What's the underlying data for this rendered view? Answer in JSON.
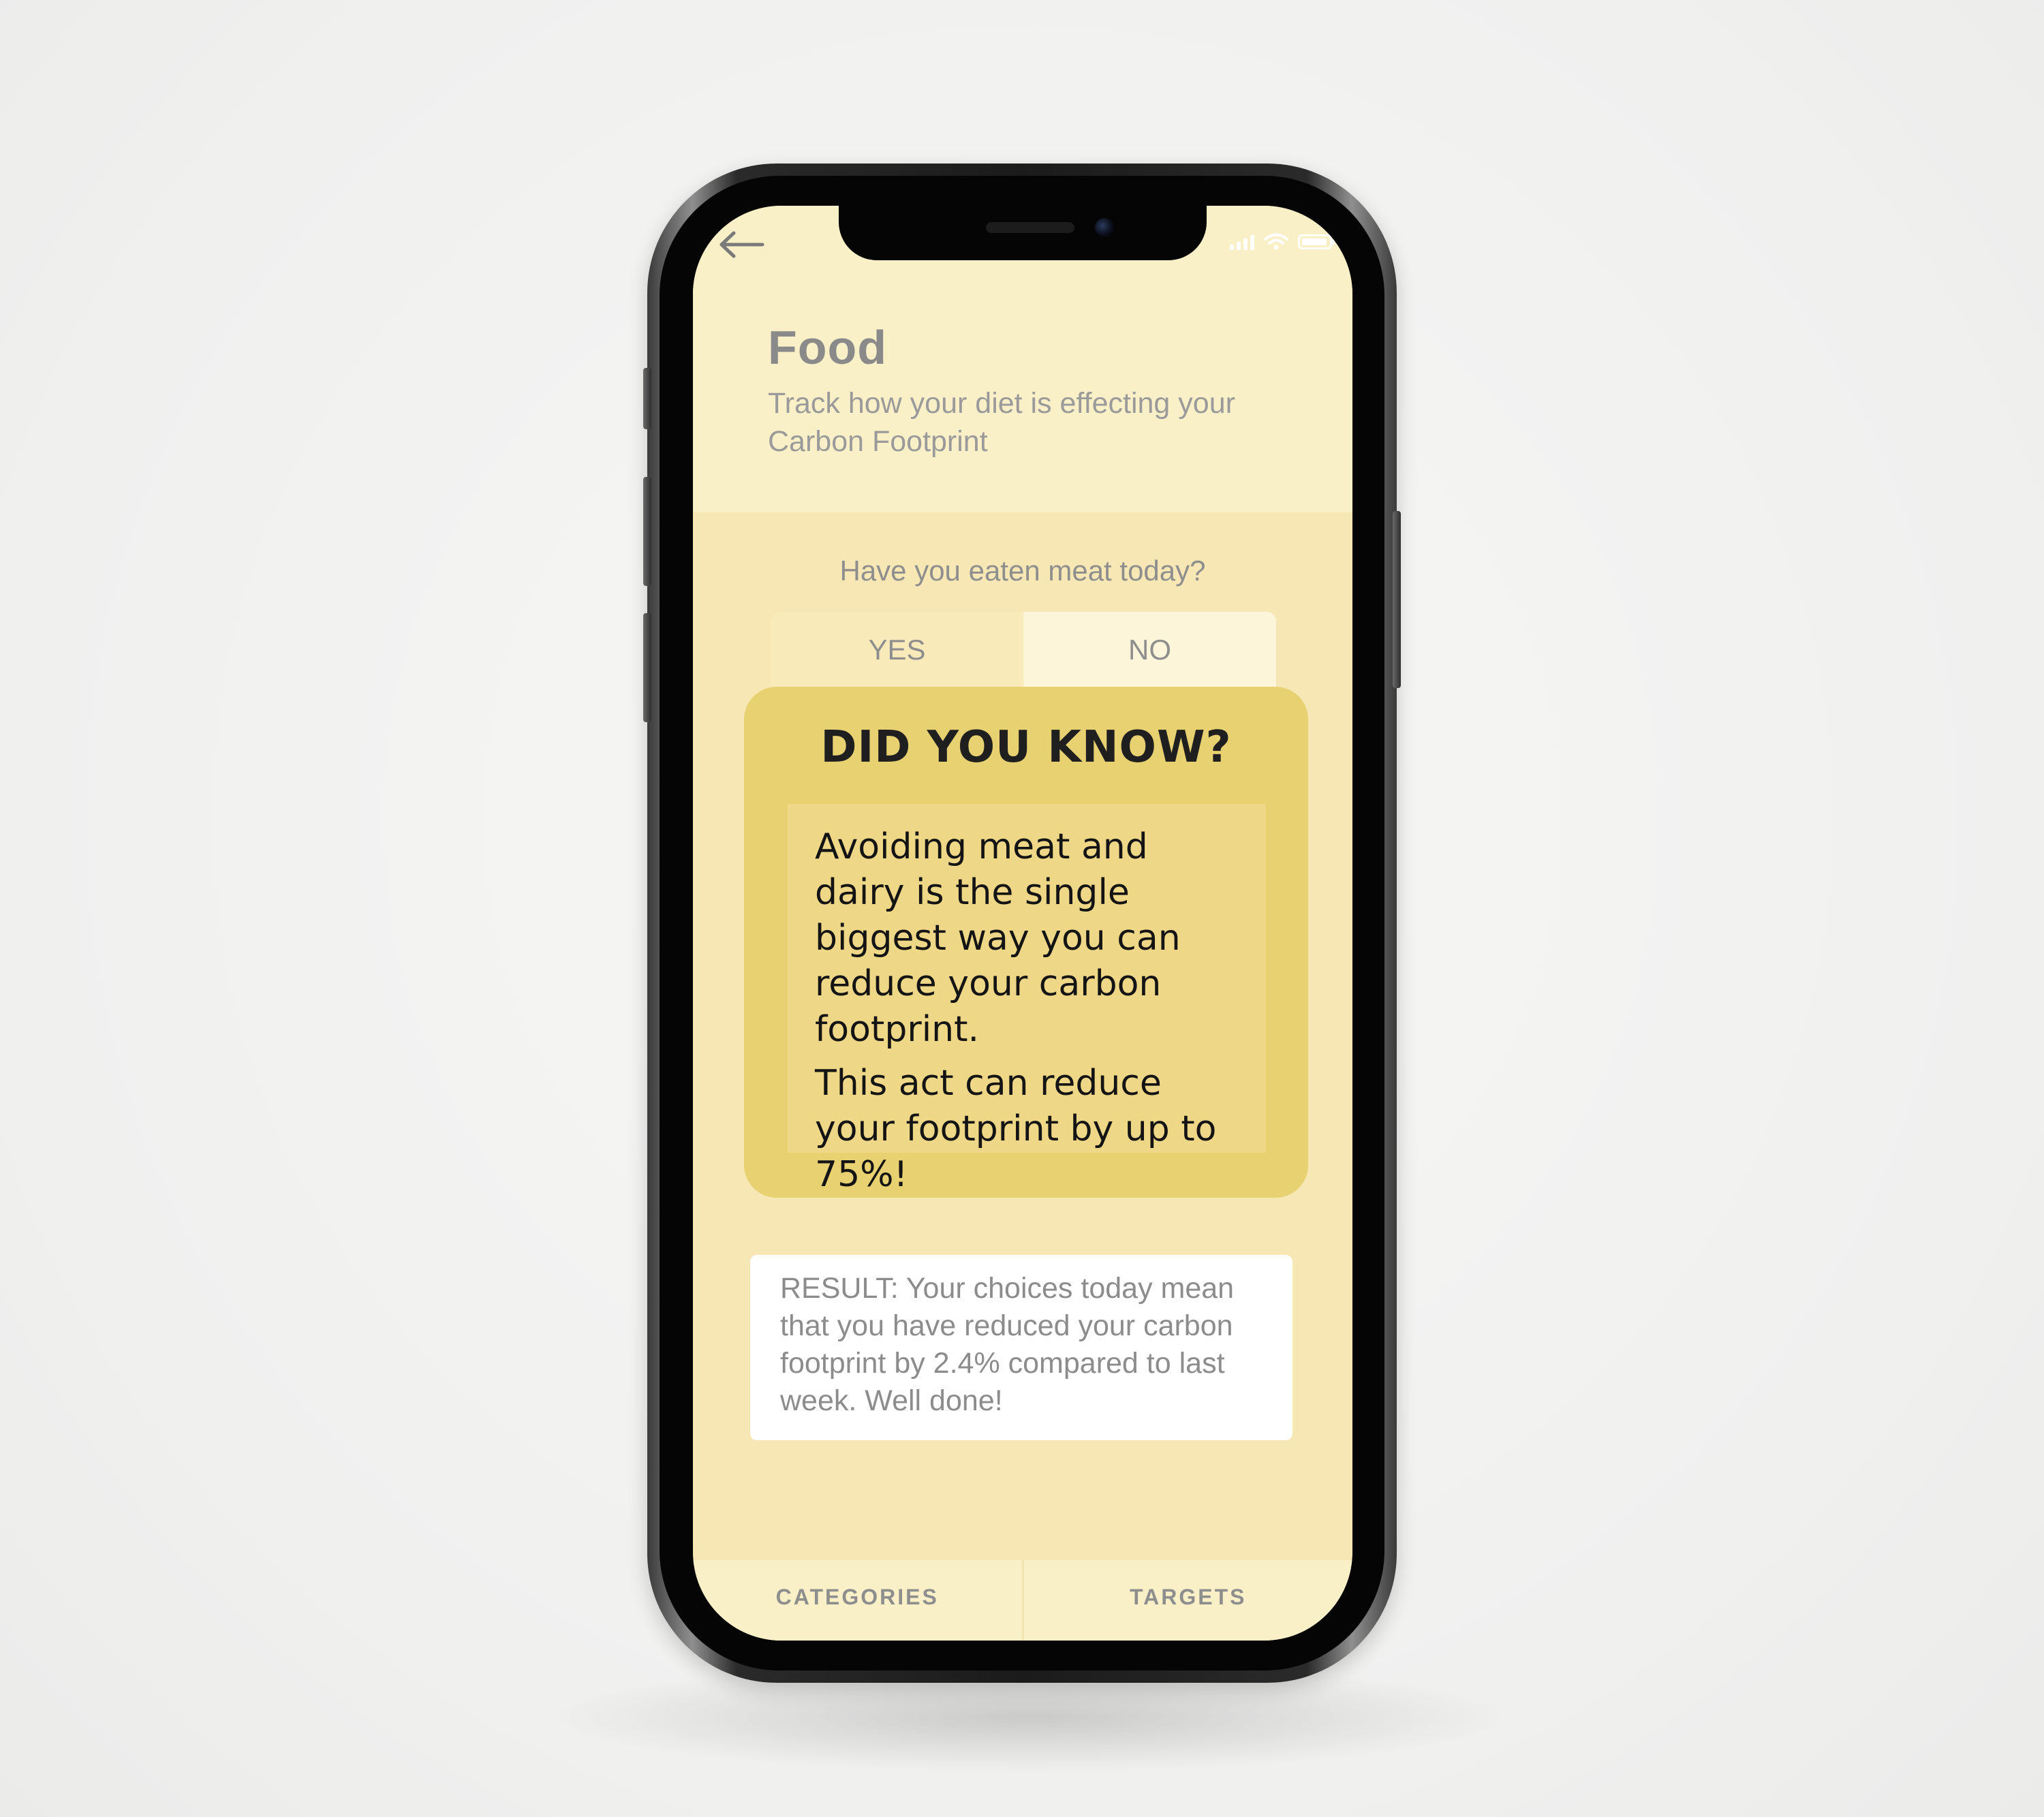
{
  "screen": {
    "title": "Food",
    "subtitle": "Track how your diet is effecting your Carbon Footprint",
    "back_icon": "back-arrow-icon"
  },
  "status_bar": {
    "icons": [
      "signal-icon",
      "wifi-icon",
      "battery-icon"
    ]
  },
  "question": {
    "text": "Have you eaten meat today?",
    "options": {
      "yes": "YES",
      "no": "NO"
    }
  },
  "fact_card": {
    "title": "DID YOU KNOW?",
    "paragraph1": "Avoiding meat and dairy is the single biggest way you can reduce your carbon footprint.",
    "paragraph2": "This act can reduce your footprint by up to 75%!"
  },
  "result": {
    "text": "RESULT:  Your choices today mean that you have reduced your carbon footprint by 2.4% compared to last week. Well done!"
  },
  "tab_bar": {
    "categories": "CATEGORIES",
    "targets": "TARGETS"
  },
  "colors": {
    "screen_background": "#f6e7b4",
    "header_background": "#faf0c8",
    "card_background": "#e8d170",
    "card_inner_background": "#eed787",
    "text_gray": "#8e8e8e",
    "text_dark": "#141414"
  }
}
